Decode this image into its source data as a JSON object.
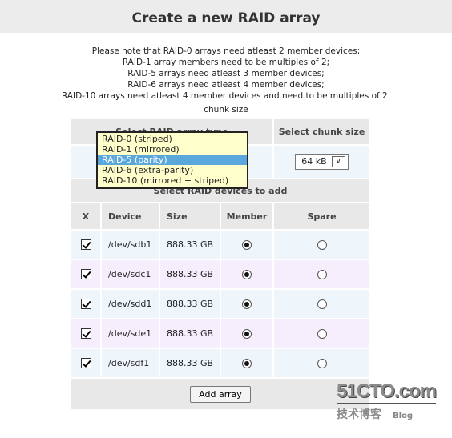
{
  "title": "Create a new RAID array",
  "notes": [
    "Please note that RAID-0 arrays need atleast 2 member devices;",
    "RAID-1 array members need to be multiples of 2;",
    "RAID-5 arrays need atleast 3 member devices;",
    "RAID-6 arrays need atleast 4 member devices;",
    "RAID-10 arrays need atleast 4 member devices and need to be multiples of 2."
  ],
  "chunk_label": "chunk size",
  "headers": {
    "raid_type": "Select RAID array type",
    "chunk_size": "Select chunk size",
    "devices": "Select RAID devices to add",
    "x": "X",
    "device": "Device",
    "size": "Size",
    "member": "Member",
    "spare": "Spare"
  },
  "chunk_value": "64 kB",
  "raid_options": [
    "RAID-0 (striped)",
    "RAID-1 (mirrored)",
    "RAID-5 (parity)",
    "RAID-6 (extra-parity)",
    "RAID-10 (mirrored + striped)"
  ],
  "raid_selected": "RAID-5 (parity)",
  "devices": [
    {
      "name": "/dev/sdb1",
      "size": "888.33 GB",
      "checked": true,
      "role": "member"
    },
    {
      "name": "/dev/sdc1",
      "size": "888.33 GB",
      "checked": true,
      "role": "member"
    },
    {
      "name": "/dev/sdd1",
      "size": "888.33 GB",
      "checked": true,
      "role": "member"
    },
    {
      "name": "/dev/sde1",
      "size": "888.33 GB",
      "checked": true,
      "role": "member"
    },
    {
      "name": "/dev/sdf1",
      "size": "888.33 GB",
      "checked": true,
      "role": "member"
    }
  ],
  "add_button": "Add array",
  "watermark": {
    "logo": "51CTO.com",
    "sub": "技术博客",
    "blog": "Blog"
  },
  "colors": {
    "row_blue": "#eef6fc",
    "row_pink": "#f6eefc",
    "header_gray": "#e8e8e8",
    "highlight": "#5aa8db",
    "dropdown_bg": "#ffffcc"
  }
}
